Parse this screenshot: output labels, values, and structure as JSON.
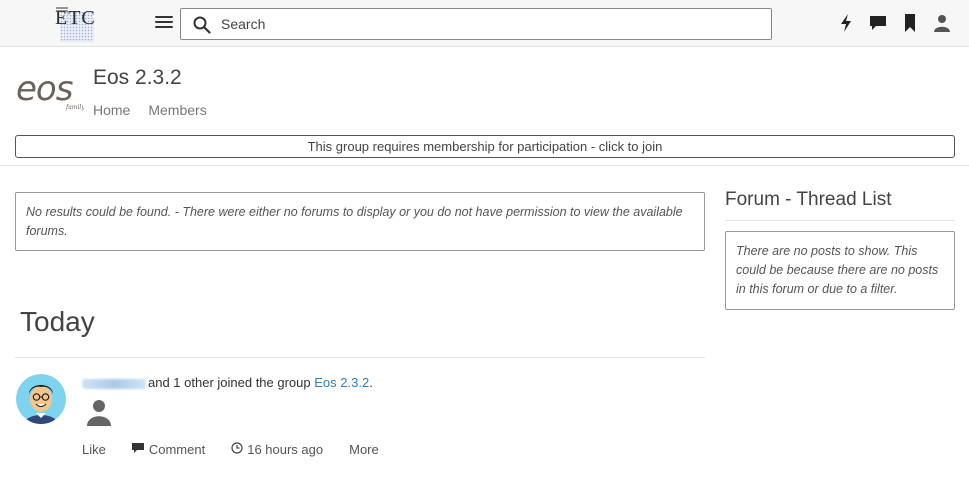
{
  "topbar": {
    "logo_text": "ETC",
    "search_placeholder": "Search",
    "icons": [
      "menu-icon",
      "search-icon",
      "lightning-icon",
      "chat-icon",
      "bookmark-icon",
      "user-icon"
    ]
  },
  "group": {
    "logo_text": "eos",
    "logo_subtext": "family",
    "title": "Eos 2.3.2",
    "nav": [
      "Home",
      "Members"
    ],
    "join_text": "This group requires membership for participation - click to join"
  },
  "forums": {
    "empty_text": "No results could be found. - There were either no forums to display or you do not have permission to view the available forums."
  },
  "sidebar": {
    "title": "Forum - Thread List",
    "empty_text": "There are no posts to show. This could be because there are no posts in this forum or due to a filter."
  },
  "activity": {
    "heading": "Today",
    "story_text": "and 1 other joined the group",
    "group_link": "Eos 2.3.2",
    "story_suffix": ".",
    "actions": {
      "like": "Like",
      "comment": "Comment",
      "time": "16 hours ago",
      "more": "More"
    }
  },
  "colors": {
    "link": "#2a7fc1",
    "topbar_bg": "#f7f7f7",
    "border": "#999999"
  }
}
